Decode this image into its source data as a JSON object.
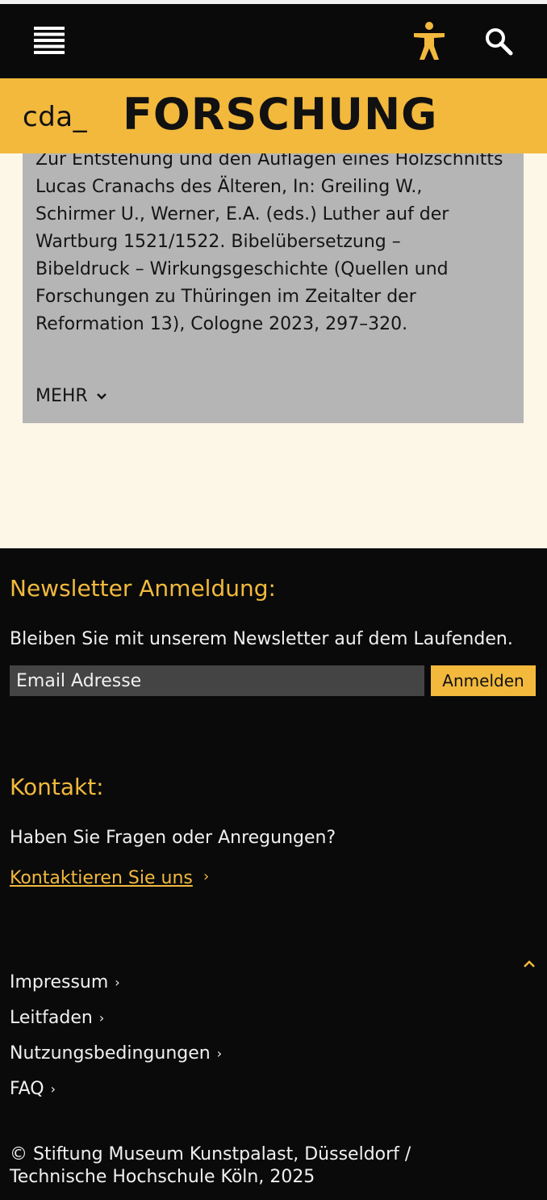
{
  "header": {
    "menu_icon": "hamburger-icon",
    "accessibility_icon": "accessibility-person-icon",
    "search_icon": "search-icon",
    "brand_logo": "cda_",
    "section_title": "FORSCHUNG",
    "accent_color": "#f2b93d"
  },
  "publication": {
    "text": "Zur Entstehung und den Auflagen eines Holzschnitts\nLucas Cranachs des Älteren, In: Greiling W.,\nSchirmer U., Werner, E.A. (eds.) Luther auf der\nWartburg 1521/1522. Bibelübersetzung –\nBibeldruck – Wirkungsgeschichte (Quellen und\nForschungen zu Thüringen im Zeitalter der\nReformation 13), Cologne 2023, 297–320.",
    "more_label": "MEHR",
    "more_icon": "chevron-down-icon"
  },
  "footer": {
    "newsletter_title": "Newsletter Anmeldung:",
    "newsletter_text": "Bleiben Sie mit unserem Newsletter auf dem Laufenden.",
    "email_placeholder": "Email Adresse",
    "subscribe_label": "Anmelden",
    "contact_title": "Kontakt:",
    "contact_text": "Haben Sie Fragen oder Anregungen?",
    "contact_link": "Kontaktieren Sie uns",
    "back_to_top_icon": "chevron-up-icon",
    "links": [
      {
        "label": "Impressum"
      },
      {
        "label": "Leitfaden"
      },
      {
        "label": "Nutzungsbedingungen"
      },
      {
        "label": "FAQ"
      }
    ],
    "copyright": "© Stiftung Museum Kunstpalast, Düsseldorf /\nTechnische Hochschule Köln, 2025"
  }
}
